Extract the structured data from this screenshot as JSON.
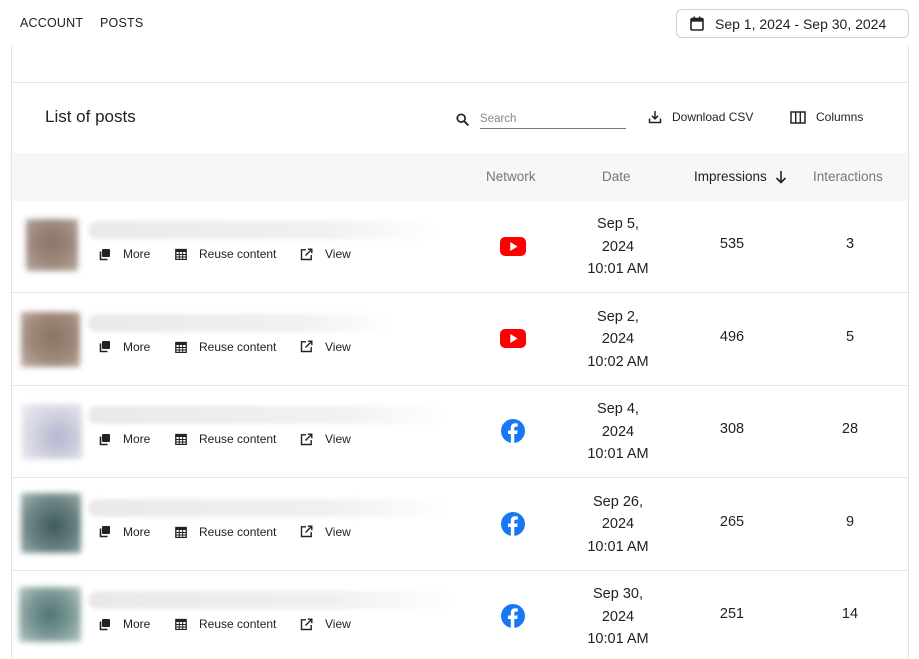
{
  "nav": {
    "account": "ACCOUNT",
    "posts": "POSTS"
  },
  "date_range": "Sep 1, 2024 - Sep 30, 2024",
  "panel": {
    "title": "List of posts",
    "search_placeholder": "Search",
    "download_label": "Download CSV",
    "columns_label": "Columns"
  },
  "table": {
    "headers": {
      "network": "Network",
      "date": "Date",
      "impressions": "Impressions",
      "interactions": "Interactions"
    },
    "sort": {
      "column": "impressions",
      "direction": "descending"
    },
    "action_labels": {
      "more": "More",
      "reuse": "Reuse content",
      "view": "View"
    },
    "rows": [
      {
        "network": "youtube",
        "date_line1": "Sep 5,",
        "date_line2": "2024",
        "time": "10:01 AM",
        "impressions": "535",
        "interactions": "3"
      },
      {
        "network": "youtube",
        "date_line1": "Sep 2,",
        "date_line2": "2024",
        "time": "10:02 AM",
        "impressions": "496",
        "interactions": "5"
      },
      {
        "network": "facebook",
        "date_line1": "Sep 4,",
        "date_line2": "2024",
        "time": "10:01 AM",
        "impressions": "308",
        "interactions": "28"
      },
      {
        "network": "facebook",
        "date_line1": "Sep 26,",
        "date_line2": "2024",
        "time": "10:01 AM",
        "impressions": "265",
        "interactions": "9"
      },
      {
        "network": "facebook",
        "date_line1": "Sep 30,",
        "date_line2": "2024",
        "time": "10:01 AM",
        "impressions": "251",
        "interactions": "14"
      }
    ]
  },
  "colors": {
    "youtube": "#ff0000",
    "facebook": "#1877f2",
    "header_bg": "#f7f7f7"
  }
}
